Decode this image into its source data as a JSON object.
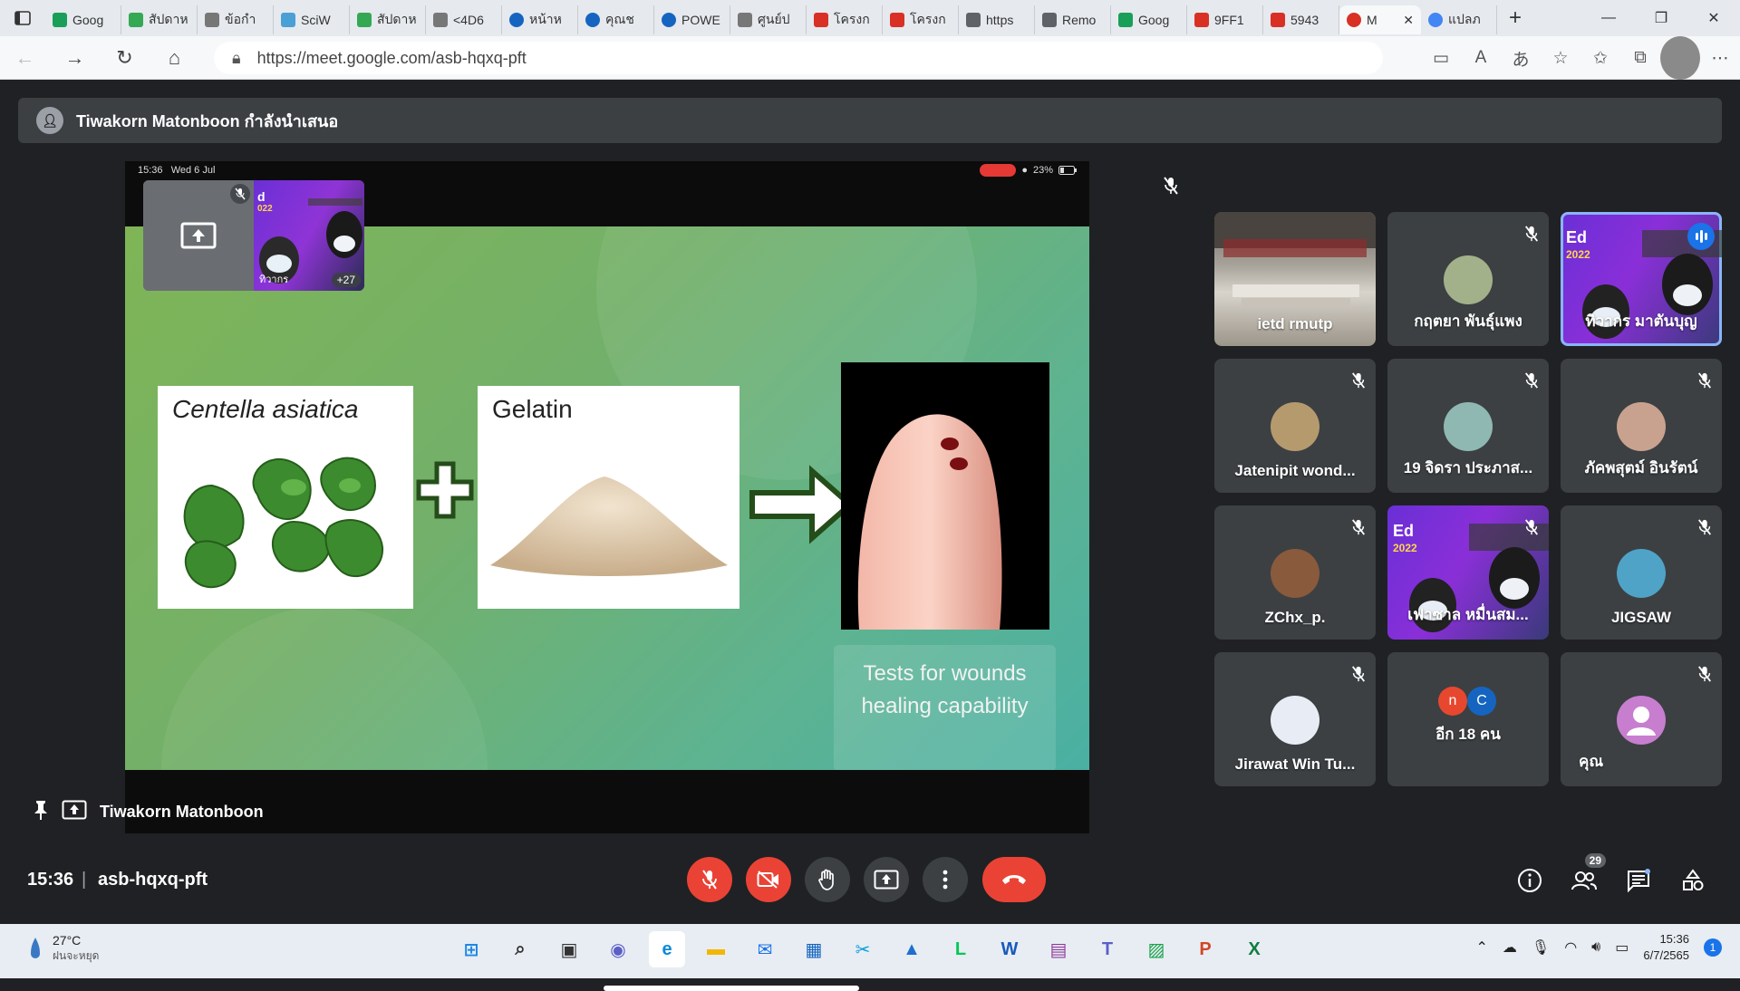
{
  "browser": {
    "tabs": [
      {
        "label": "Goog",
        "icon": "google-sheets-icon",
        "color": "#1a9f58"
      },
      {
        "label": "สัปดาห",
        "icon": "checkmark-icon",
        "color": "#34a853"
      },
      {
        "label": "ข้อกำ",
        "icon": "document-icon",
        "color": "#777777"
      },
      {
        "label": "SciW",
        "icon": "sciwork-icon",
        "color": "#4aa0d5"
      },
      {
        "label": "สัปดาห",
        "icon": "checkmark-icon",
        "color": "#34a853"
      },
      {
        "label": "<4D6",
        "icon": "document-icon",
        "color": "#777777"
      },
      {
        "label": "หน้าห",
        "icon": "edge-icon",
        "color": "#1565c0"
      },
      {
        "label": "คุณช",
        "icon": "edge-icon",
        "color": "#1565c0"
      },
      {
        "label": "POWE",
        "icon": "edge-icon",
        "color": "#1565c0"
      },
      {
        "label": "ศูนย์ป",
        "icon": "document-icon",
        "color": "#777777"
      },
      {
        "label": "โครงก",
        "icon": "pdf-icon",
        "color": "#d93025"
      },
      {
        "label": "โครงก",
        "icon": "pdf-icon",
        "color": "#d93025"
      },
      {
        "label": "https",
        "icon": "search-icon",
        "color": "#5f6368"
      },
      {
        "label": "Remo",
        "icon": "cloud-icon",
        "color": "#5f6368"
      },
      {
        "label": "Goog",
        "icon": "google-sheets-icon",
        "color": "#1a9f58"
      },
      {
        "label": "9FF1",
        "icon": "pdf-icon",
        "color": "#d93025"
      },
      {
        "label": "5943",
        "icon": "pdf-icon",
        "color": "#d93025"
      },
      {
        "label": "M",
        "icon": "record-icon",
        "color": "#d93025",
        "active": true
      },
      {
        "label": "แปลภ",
        "icon": "google-icon",
        "color": "#4285f4"
      }
    ],
    "url": "https://meet.google.com/asb-hqxq-pft",
    "tab_close": "✕",
    "new_tab": "+",
    "menu_icon": "tab-actions-icon"
  },
  "meeting": {
    "presenting_banner": "Tiwakorn Matonboon กำลังนำเสนอ",
    "presenter_name": "Tiwakorn Matonboon",
    "time": "15:36",
    "code": "asb-hqxq-pft",
    "participants_count": "29",
    "separator": "|"
  },
  "tablet_status": {
    "time": "15:36",
    "date": "Wed 6 Jul",
    "battery": "23%"
  },
  "slide": {
    "card1_title": "Centella asiatica",
    "card2_title": "Gelatin",
    "tests_text_line1": "Tests for wounds",
    "tests_text_line2": "healing capability"
  },
  "thumbnail": {
    "overlay_count": "+27",
    "name": "ทิวากร",
    "ed_text": "d",
    "ed_year": "022"
  },
  "tiles": [
    {
      "name": "ietd rmutp",
      "type": "video-room",
      "muted": false
    },
    {
      "name": "กฤตยา พันธุ์แพง",
      "type": "avatar",
      "muted": true,
      "color": "#a3b18a"
    },
    {
      "name": "ทิวากร มาตันบุญ",
      "type": "video-ed",
      "muted": false,
      "speaking": true,
      "ed_text": "Ed",
      "ed_year": "2022"
    },
    {
      "name": "Jatenipit wond...",
      "type": "avatar",
      "muted": true,
      "color": "#b59a6e"
    },
    {
      "name": "19 จิดรา ประภาส...",
      "type": "avatar",
      "muted": true,
      "color": "#8fb8b3"
    },
    {
      "name": "ภัคพสุตม์ อินรัตน์",
      "type": "avatar",
      "muted": true,
      "color": "#c9a28f"
    },
    {
      "name": "ZChx_p.",
      "type": "avatar",
      "muted": true,
      "color": "#8a5a3c"
    },
    {
      "name": "เฟาซาล หมื่นสม...",
      "type": "video-ed",
      "muted": true,
      "ed_text": "Ed",
      "ed_year": "2022"
    },
    {
      "name": "JIGSAW",
      "type": "avatar",
      "muted": true,
      "color": "#4fa3c7"
    },
    {
      "name": "Jirawat Win Tu...",
      "type": "avatar",
      "muted": true,
      "color": "#e8ecf5"
    },
    {
      "name": "อีก 18 คน",
      "type": "more",
      "muted": false,
      "avatar1": "n",
      "avatar2": "C"
    },
    {
      "name": "คุณ",
      "type": "self",
      "muted": true,
      "color": "#c77ecf"
    }
  ],
  "taskbar": {
    "temp": "27°C",
    "weather": "ฝนจะหยุด",
    "clock_time": "15:36",
    "clock_date": "6/7/2565",
    "notif_count": "1",
    "apps": [
      {
        "icon": "windows-start-icon",
        "color": "#1e88e5",
        "glyph": "⊞"
      },
      {
        "icon": "search-icon",
        "color": "#333333",
        "glyph": "⌕"
      },
      {
        "icon": "task-view-icon",
        "color": "#333333",
        "glyph": "▣"
      },
      {
        "icon": "chat-icon",
        "color": "#5b5fc7",
        "glyph": "◉"
      },
      {
        "icon": "edge-icon",
        "color": "#0c8bd6",
        "glyph": "e"
      },
      {
        "icon": "file-explorer-icon",
        "color": "#f2b705",
        "glyph": "▬"
      },
      {
        "icon": "mail-icon",
        "color": "#1a73e8",
        "glyph": "✉"
      },
      {
        "icon": "store-icon",
        "color": "#1565c0",
        "glyph": "▦"
      },
      {
        "icon": "snipping-tool-icon",
        "color": "#0aa0d8",
        "glyph": "✂"
      },
      {
        "icon": "photos-icon",
        "color": "#1e6fd0",
        "glyph": "▲"
      },
      {
        "icon": "line-icon",
        "color": "#06c755",
        "glyph": "L"
      },
      {
        "icon": "word-icon",
        "color": "#185abd",
        "glyph": "W"
      },
      {
        "icon": "winrar-icon",
        "color": "#8e3b9a",
        "glyph": "▤"
      },
      {
        "icon": "teams-icon",
        "color": "#5b5fc7",
        "glyph": "T"
      },
      {
        "icon": "photo-editor-icon",
        "color": "#17a34a",
        "glyph": "▨"
      },
      {
        "icon": "powerpoint-icon",
        "color": "#d24726",
        "glyph": "P"
      },
      {
        "icon": "excel-icon",
        "color": "#107c41",
        "glyph": "X"
      }
    ]
  },
  "colors": {
    "meet_bg": "#202124",
    "tile_bg": "#3c4043",
    "red": "#ea4335",
    "speaking_outline": "#8ab4f8"
  }
}
